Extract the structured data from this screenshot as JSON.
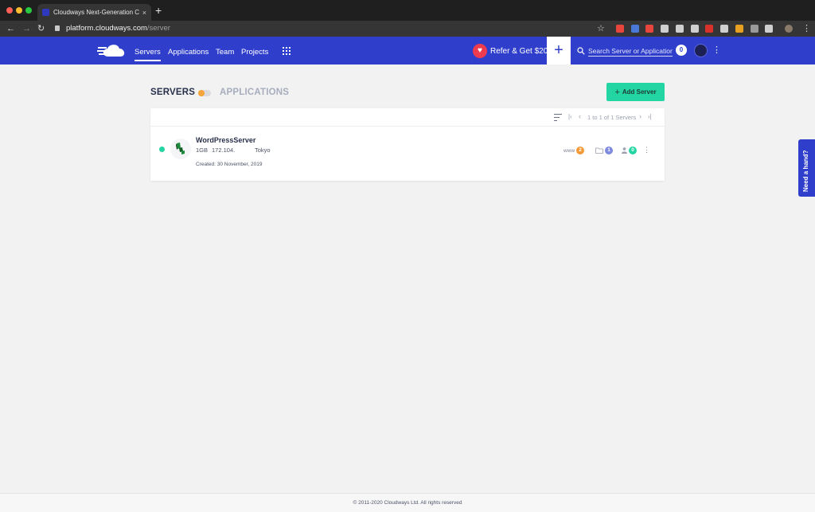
{
  "browser": {
    "tab_title": "Cloudways Next-Generation C...",
    "tab_close": "×",
    "new_tab": "+",
    "url_host": "platform.cloudways.com",
    "url_path": "/server",
    "back": "←",
    "forward": "→",
    "reload": "↻",
    "star": "☆",
    "menu": "⋮",
    "extension_colors": [
      "#e8453c",
      "#4a78d8",
      "#e8453c",
      "#cfcfcf",
      "#cfcfcf",
      "#cfcfcf",
      "#d8312b",
      "#cfcfcf",
      "#e8a020",
      "#9a9a9a",
      "#cfcfcf",
      "#4a78d8"
    ]
  },
  "header": {
    "nav": [
      "Servers",
      "Applications",
      "Team",
      "Projects"
    ],
    "active_nav": "Servers",
    "refer_label": "Refer & Get $20",
    "refer_icon": "♥",
    "plus": "+",
    "search_placeholder": "Search Server or Application",
    "notification_count": "0",
    "kebab": "⋮",
    "brand_color": "#2f3ecb"
  },
  "page": {
    "servers_heading": "SERVERS",
    "applications_heading": "APPLICATIONS",
    "add_server_label": "Add Server",
    "add_server_plus": "+",
    "accent_color": "#24d5a4"
  },
  "pager": {
    "first": "|‹",
    "prev": "‹",
    "summary": "1 to 1 of 1 Servers",
    "next": "›",
    "last": "›|"
  },
  "servers": [
    {
      "name": "WordPressServer",
      "size": "1GB",
      "ip": "172.104.",
      "location": "Tokyo",
      "created": "Created: 30 November, 2019",
      "status": "running",
      "www_label": "www",
      "www_count": "2",
      "www_color": "#f39a36",
      "projects_count": "1",
      "projects_color": "#7f89dd",
      "users_count": "0",
      "users_color": "#24d5a4",
      "kebab": "⋮"
    }
  ],
  "help": {
    "label": "Need a hand?"
  },
  "footer": {
    "text": "© 2011-2020 Cloudways Ltd. All rights reserved"
  }
}
